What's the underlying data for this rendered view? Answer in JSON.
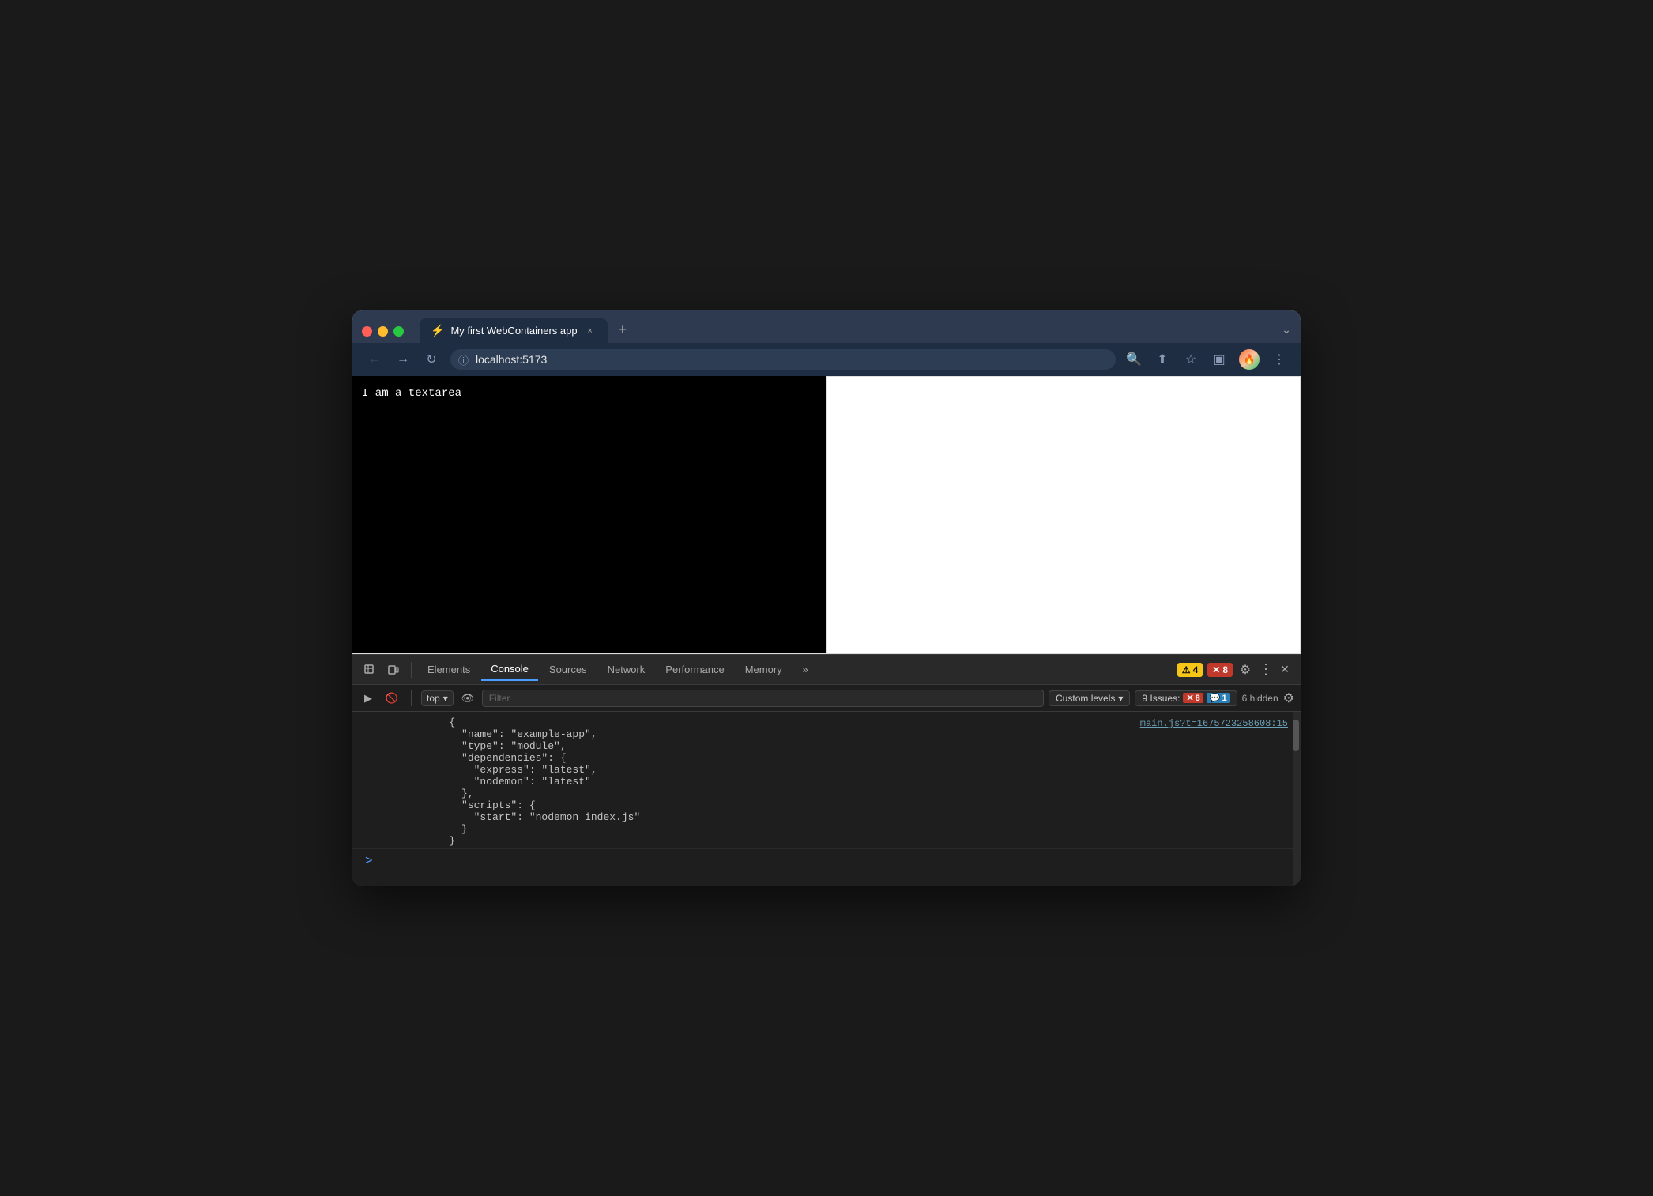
{
  "browser": {
    "window_controls": {
      "dot_red": "red",
      "dot_yellow": "yellow",
      "dot_green": "green"
    },
    "tab": {
      "icon": "⚡",
      "title": "My first WebContainers app",
      "close": "×"
    },
    "tab_new_label": "+",
    "tab_more_label": "⌄",
    "address_bar": {
      "url": "localhost:5173",
      "lock_icon": "ⓘ"
    },
    "toolbar": {
      "back_icon": "←",
      "forward_icon": "→",
      "reload_icon": "↻",
      "search_icon": "🔍",
      "share_icon": "⬆",
      "star_icon": "☆",
      "sidebar_icon": "▣",
      "more_icon": "⋮"
    }
  },
  "page": {
    "textarea_text": "I am a textarea"
  },
  "devtools": {
    "tabs": [
      {
        "id": "elements",
        "label": "Elements",
        "active": false
      },
      {
        "id": "console",
        "label": "Console",
        "active": true
      },
      {
        "id": "sources",
        "label": "Sources",
        "active": false
      },
      {
        "id": "network",
        "label": "Network",
        "active": false
      },
      {
        "id": "performance",
        "label": "Performance",
        "active": false
      },
      {
        "id": "memory",
        "label": "Memory",
        "active": false
      }
    ],
    "more_tabs_icon": "»",
    "warning_count": "4",
    "error_count": "8",
    "gear_icon": "⚙",
    "more_icon": "⋮",
    "close_icon": "×",
    "console": {
      "execute_icon": "▶",
      "clear_icon": "🚫",
      "context": "top",
      "context_arrow": "▾",
      "eye_icon": "👁",
      "filter_placeholder": "Filter",
      "custom_levels_label": "Custom levels",
      "custom_levels_arrow": "▾",
      "issues_label": "9 Issues:",
      "issues_error_count": "8",
      "issues_info_count": "1",
      "hidden_label": "6 hidden",
      "gear_icon": "⚙",
      "source_link": "main.js?t=1675723258608:15",
      "output": [
        "        {",
        "          \"name\": \"example-app\",",
        "          \"type\": \"module\",",
        "          \"dependencies\": {",
        "            \"express\": \"latest\",",
        "            \"nodemon\": \"latest\"",
        "          },",
        "          \"scripts\": {",
        "            \"start\": \"nodemon index.js\"",
        "          }",
        "        }"
      ],
      "prompt_caret": ">"
    }
  }
}
